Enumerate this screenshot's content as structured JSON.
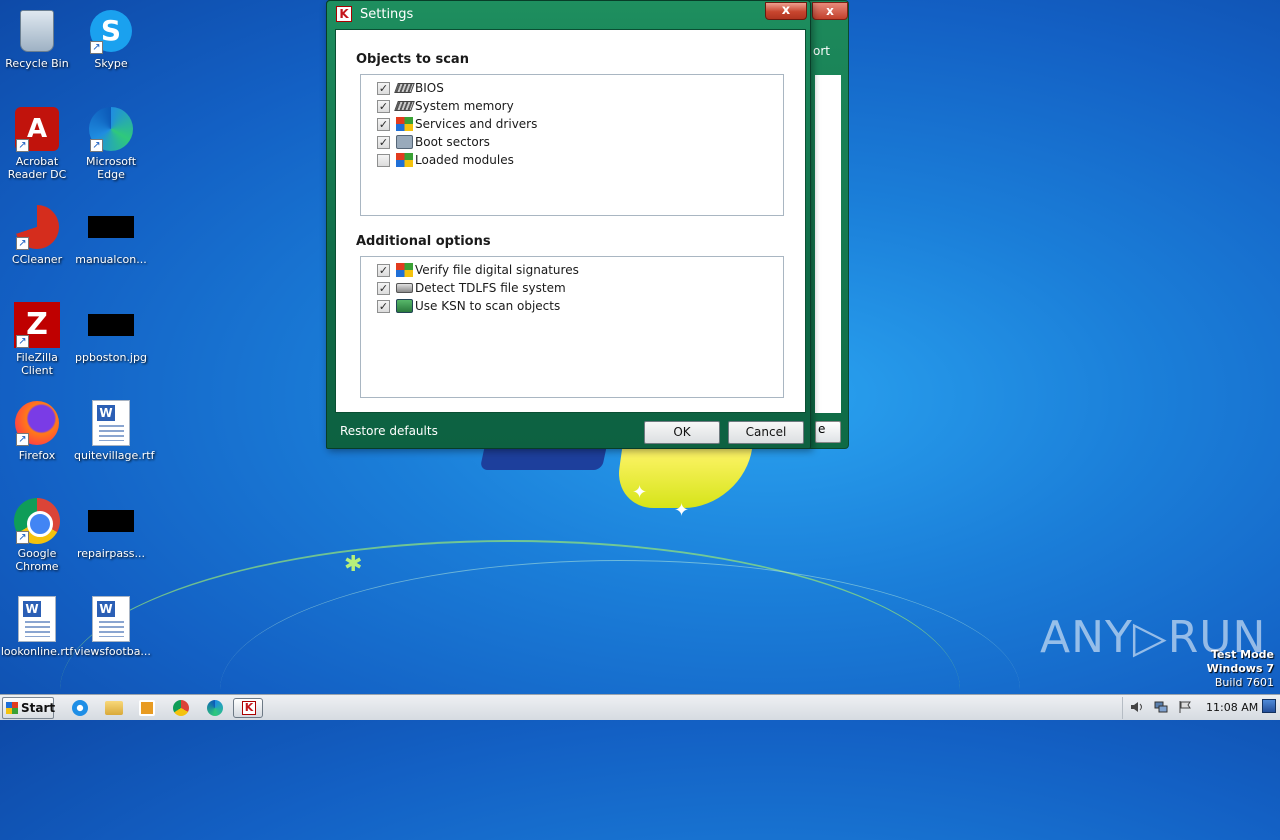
{
  "desktop": {
    "icons": [
      {
        "label": "Recycle Bin",
        "icon": "recycle-bin-icon"
      },
      {
        "label": "Skype",
        "icon": "skype-icon"
      },
      {
        "label": "Acrobat Reader DC",
        "icon": "acrobat-icon"
      },
      {
        "label": "Microsoft Edge",
        "icon": "edge-icon"
      },
      {
        "label": "CCleaner",
        "icon": "ccleaner-icon"
      },
      {
        "label": "manualcon...",
        "icon": "file-icon"
      },
      {
        "label": "FileZilla Client",
        "icon": "filezilla-icon"
      },
      {
        "label": "ppboston.jpg",
        "icon": "image-file-icon"
      },
      {
        "label": "Firefox",
        "icon": "firefox-icon"
      },
      {
        "label": "quitevillage.rtf",
        "icon": "word-document-icon"
      },
      {
        "label": "Google Chrome",
        "icon": "chrome-icon"
      },
      {
        "label": "repairpass...",
        "icon": "file-icon"
      },
      {
        "label": "lookonline.rtf",
        "icon": "word-document-icon"
      },
      {
        "label": "viewsfootba...",
        "icon": "word-document-icon"
      }
    ]
  },
  "background_window": {
    "partial_label": "ort",
    "partial_button": "e",
    "close_glyph": "x"
  },
  "dialog": {
    "title": "Settings",
    "title_icon_glyph": "K",
    "close_glyph": "x",
    "objects_section": {
      "title": "Objects to scan",
      "options": [
        {
          "label": "BIOS",
          "checked": true,
          "icon": "chip-icon"
        },
        {
          "label": "System memory",
          "checked": true,
          "icon": "chip-icon"
        },
        {
          "label": "Services and drivers",
          "checked": true,
          "icon": "windows-icon"
        },
        {
          "label": "Boot sectors",
          "checked": true,
          "icon": "boot-sector-icon"
        },
        {
          "label": "Loaded modules",
          "checked": false,
          "icon": "windows-icon"
        }
      ]
    },
    "additional_section": {
      "title": "Additional options",
      "options": [
        {
          "label": "Verify file digital signatures",
          "checked": true,
          "icon": "windows-icon"
        },
        {
          "label": "Detect TDLFS file system",
          "checked": true,
          "icon": "disk-icon"
        },
        {
          "label": "Use KSN to scan objects",
          "checked": true,
          "icon": "ksn-icon"
        }
      ]
    },
    "restore_defaults": "Restore defaults",
    "ok_label": "OK",
    "cancel_label": "Cancel"
  },
  "watermark": {
    "brand": "ANY▷RUN",
    "test_mode": "Test Mode",
    "os": "Windows 7",
    "build": "Build 7601"
  },
  "taskbar": {
    "start_label": "Start",
    "clock": "11:08 AM",
    "kav_glyph": "K"
  },
  "colors": {
    "window_green": "#1e8f5f",
    "close_red": "#c7452e",
    "desktop_blue": "#1b7fd9"
  }
}
